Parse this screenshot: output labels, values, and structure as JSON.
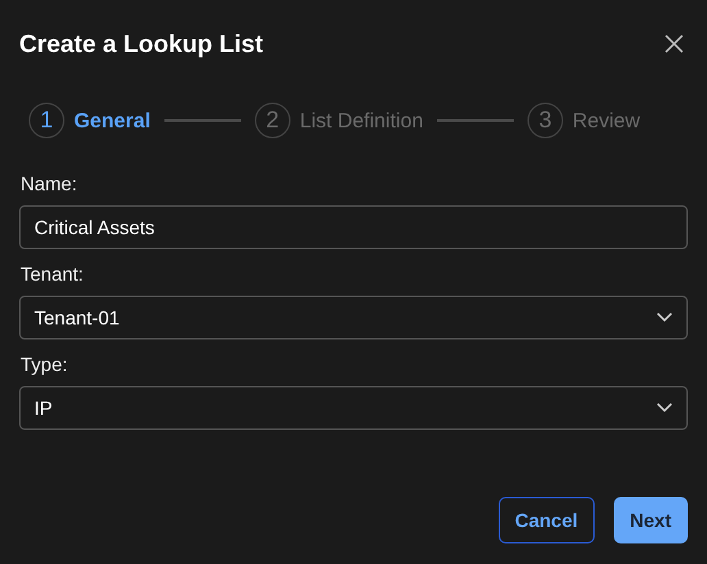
{
  "dialog": {
    "title": "Create a Lookup List"
  },
  "steps": [
    {
      "number": "1",
      "label": "General",
      "selected": true
    },
    {
      "number": "2",
      "label": "List Definition",
      "selected": false
    },
    {
      "number": "3",
      "label": "Review",
      "selected": false
    }
  ],
  "fields": [
    {
      "kind": "text",
      "label": "Name:",
      "value": "Critical Assets"
    },
    {
      "kind": "select",
      "label": "Tenant:",
      "value": "Tenant-01"
    },
    {
      "kind": "select",
      "label": "Type:",
      "value": "IP"
    }
  ],
  "buttons": [
    {
      "kind": "secondary",
      "label": "Cancel"
    },
    {
      "kind": "primary",
      "label": "Next"
    }
  ]
}
